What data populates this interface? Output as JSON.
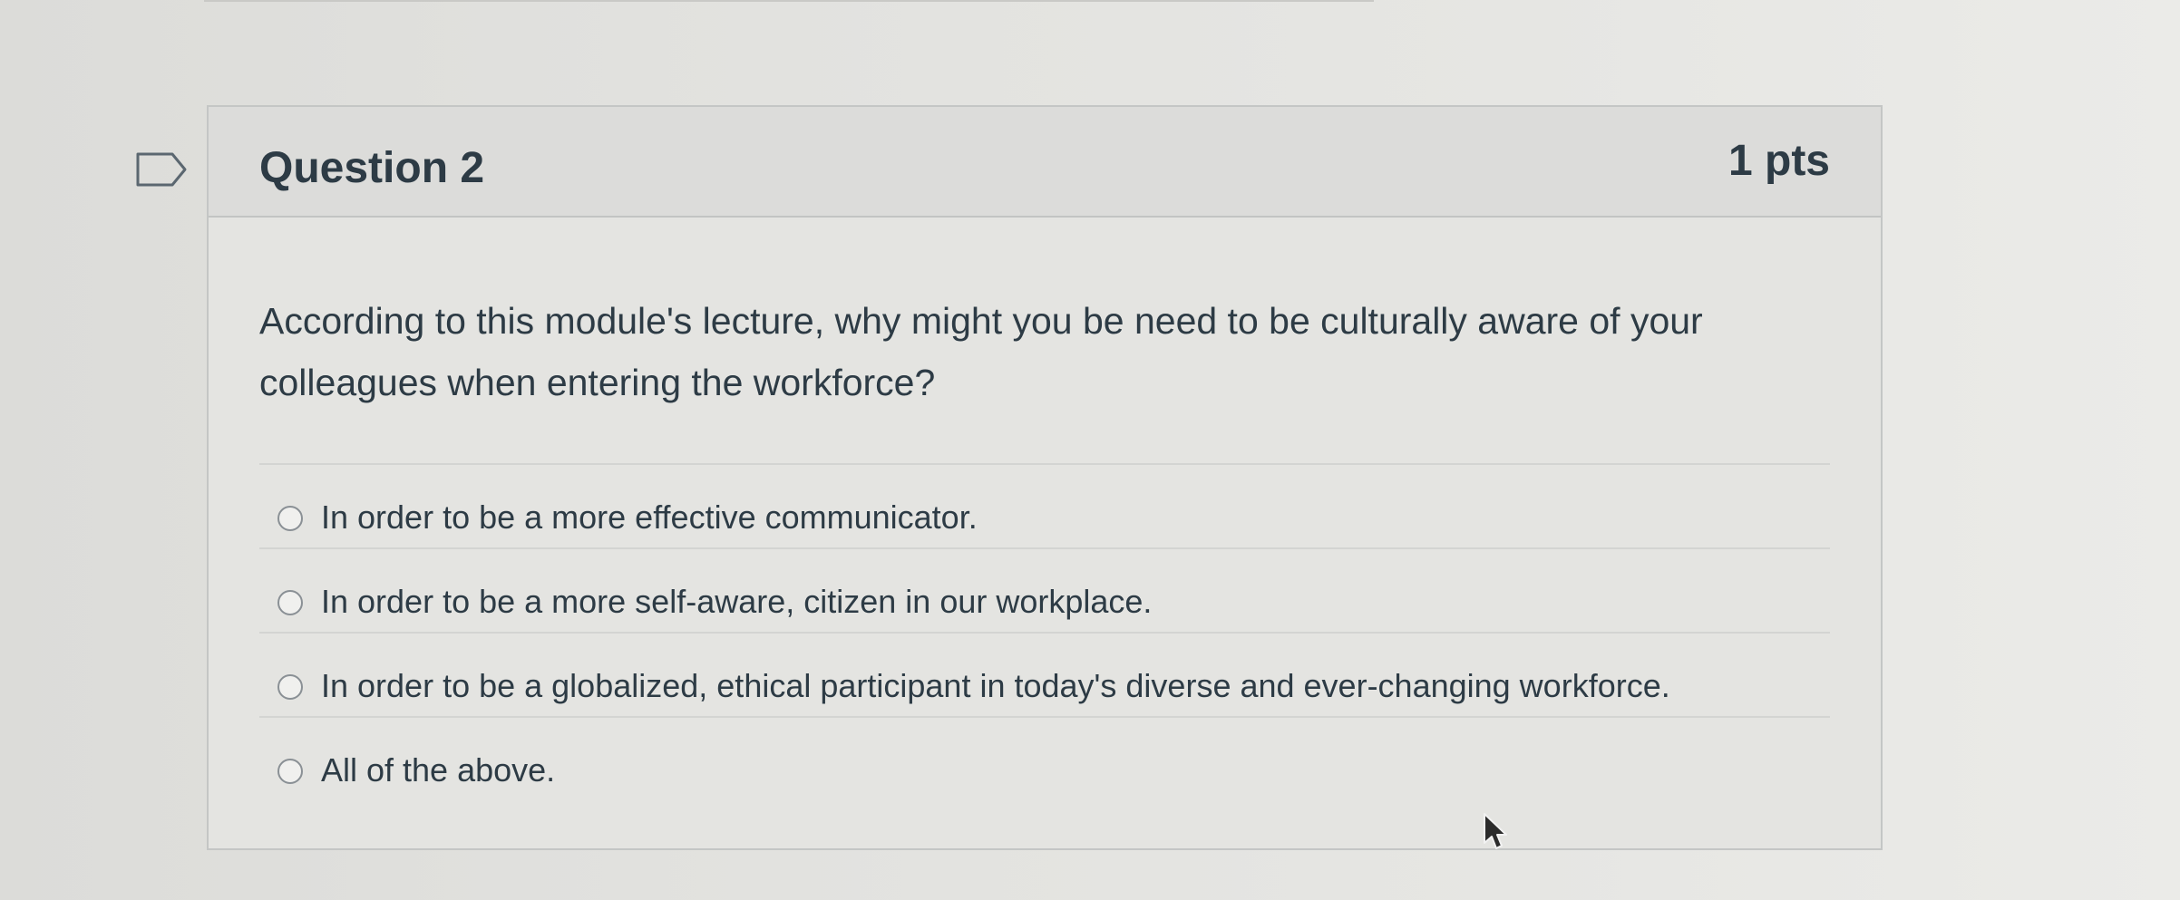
{
  "question": {
    "title": "Question 2",
    "points": "1 pts",
    "text": "According to this module's lecture, why might you be need to be culturally aware of your colleagues when entering the workforce?",
    "answers": [
      {
        "label": "In order to be a more effective communicator.",
        "selected": false
      },
      {
        "label": "In order to be a more self-aware, citizen in our workplace.",
        "selected": false
      },
      {
        "label": "In order to be a globalized, ethical participant in today's diverse and ever-changing workforce.",
        "selected": false
      },
      {
        "label": "All of the above.",
        "selected": false
      }
    ]
  },
  "icons": {
    "flag": "flag-question-icon",
    "cursor": "mouse-pointer-icon"
  },
  "colors": {
    "text": "#2d3b45",
    "header_bg": "#dcdcda",
    "border": "#c4c6c5"
  }
}
